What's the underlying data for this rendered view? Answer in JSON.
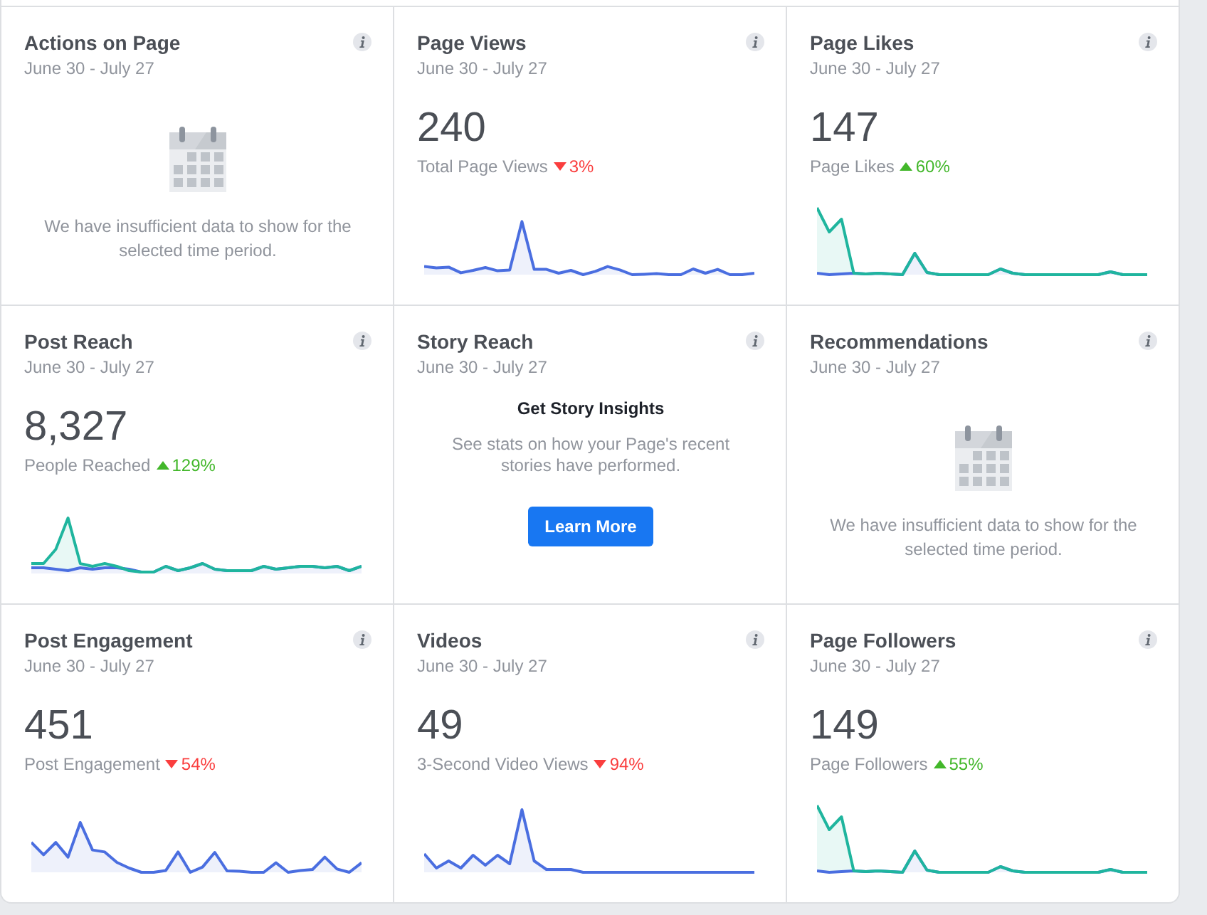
{
  "tiles": [
    {
      "kind": "empty",
      "title": "Actions on Page",
      "date_range": "June 30 - July 27",
      "message": "We have insufficient data to show for the selected time period."
    },
    {
      "kind": "metric",
      "title": "Page Views",
      "date_range": "June 30 - July 27",
      "value": "240",
      "label": "Total Page Views",
      "trend_up": false,
      "change": "3%"
    },
    {
      "kind": "metric",
      "title": "Page Likes",
      "date_range": "June 30 - July 27",
      "value": "147",
      "label": "Page Likes",
      "trend_up": true,
      "change": "60%"
    },
    {
      "kind": "metric",
      "title": "Post Reach",
      "date_range": "June 30 - July 27",
      "value": "8,327",
      "label": "People Reached",
      "trend_up": true,
      "change": "129%"
    },
    {
      "kind": "promo",
      "title": "Story Reach",
      "date_range": "June 30 - July 27",
      "heading": "Get Story Insights",
      "description": "See stats on how your Page's recent stories have performed.",
      "button": "Learn More"
    },
    {
      "kind": "empty",
      "title": "Recommendations",
      "date_range": "June 30 - July 27",
      "message": "We have insufficient data to show for the selected time period."
    },
    {
      "kind": "metric",
      "title": "Post Engagement",
      "date_range": "June 30 - July 27",
      "value": "451",
      "label": "Post Engagement",
      "trend_up": false,
      "change": "54%"
    },
    {
      "kind": "metric",
      "title": "Videos",
      "date_range": "June 30 - July 27",
      "value": "49",
      "label": "3-Second Video Views",
      "trend_up": false,
      "change": "94%"
    },
    {
      "kind": "metric",
      "title": "Page Followers",
      "date_range": "June 30 - July 27",
      "value": "149",
      "label": "Page Followers",
      "trend_up": true,
      "change": "55%"
    }
  ]
}
